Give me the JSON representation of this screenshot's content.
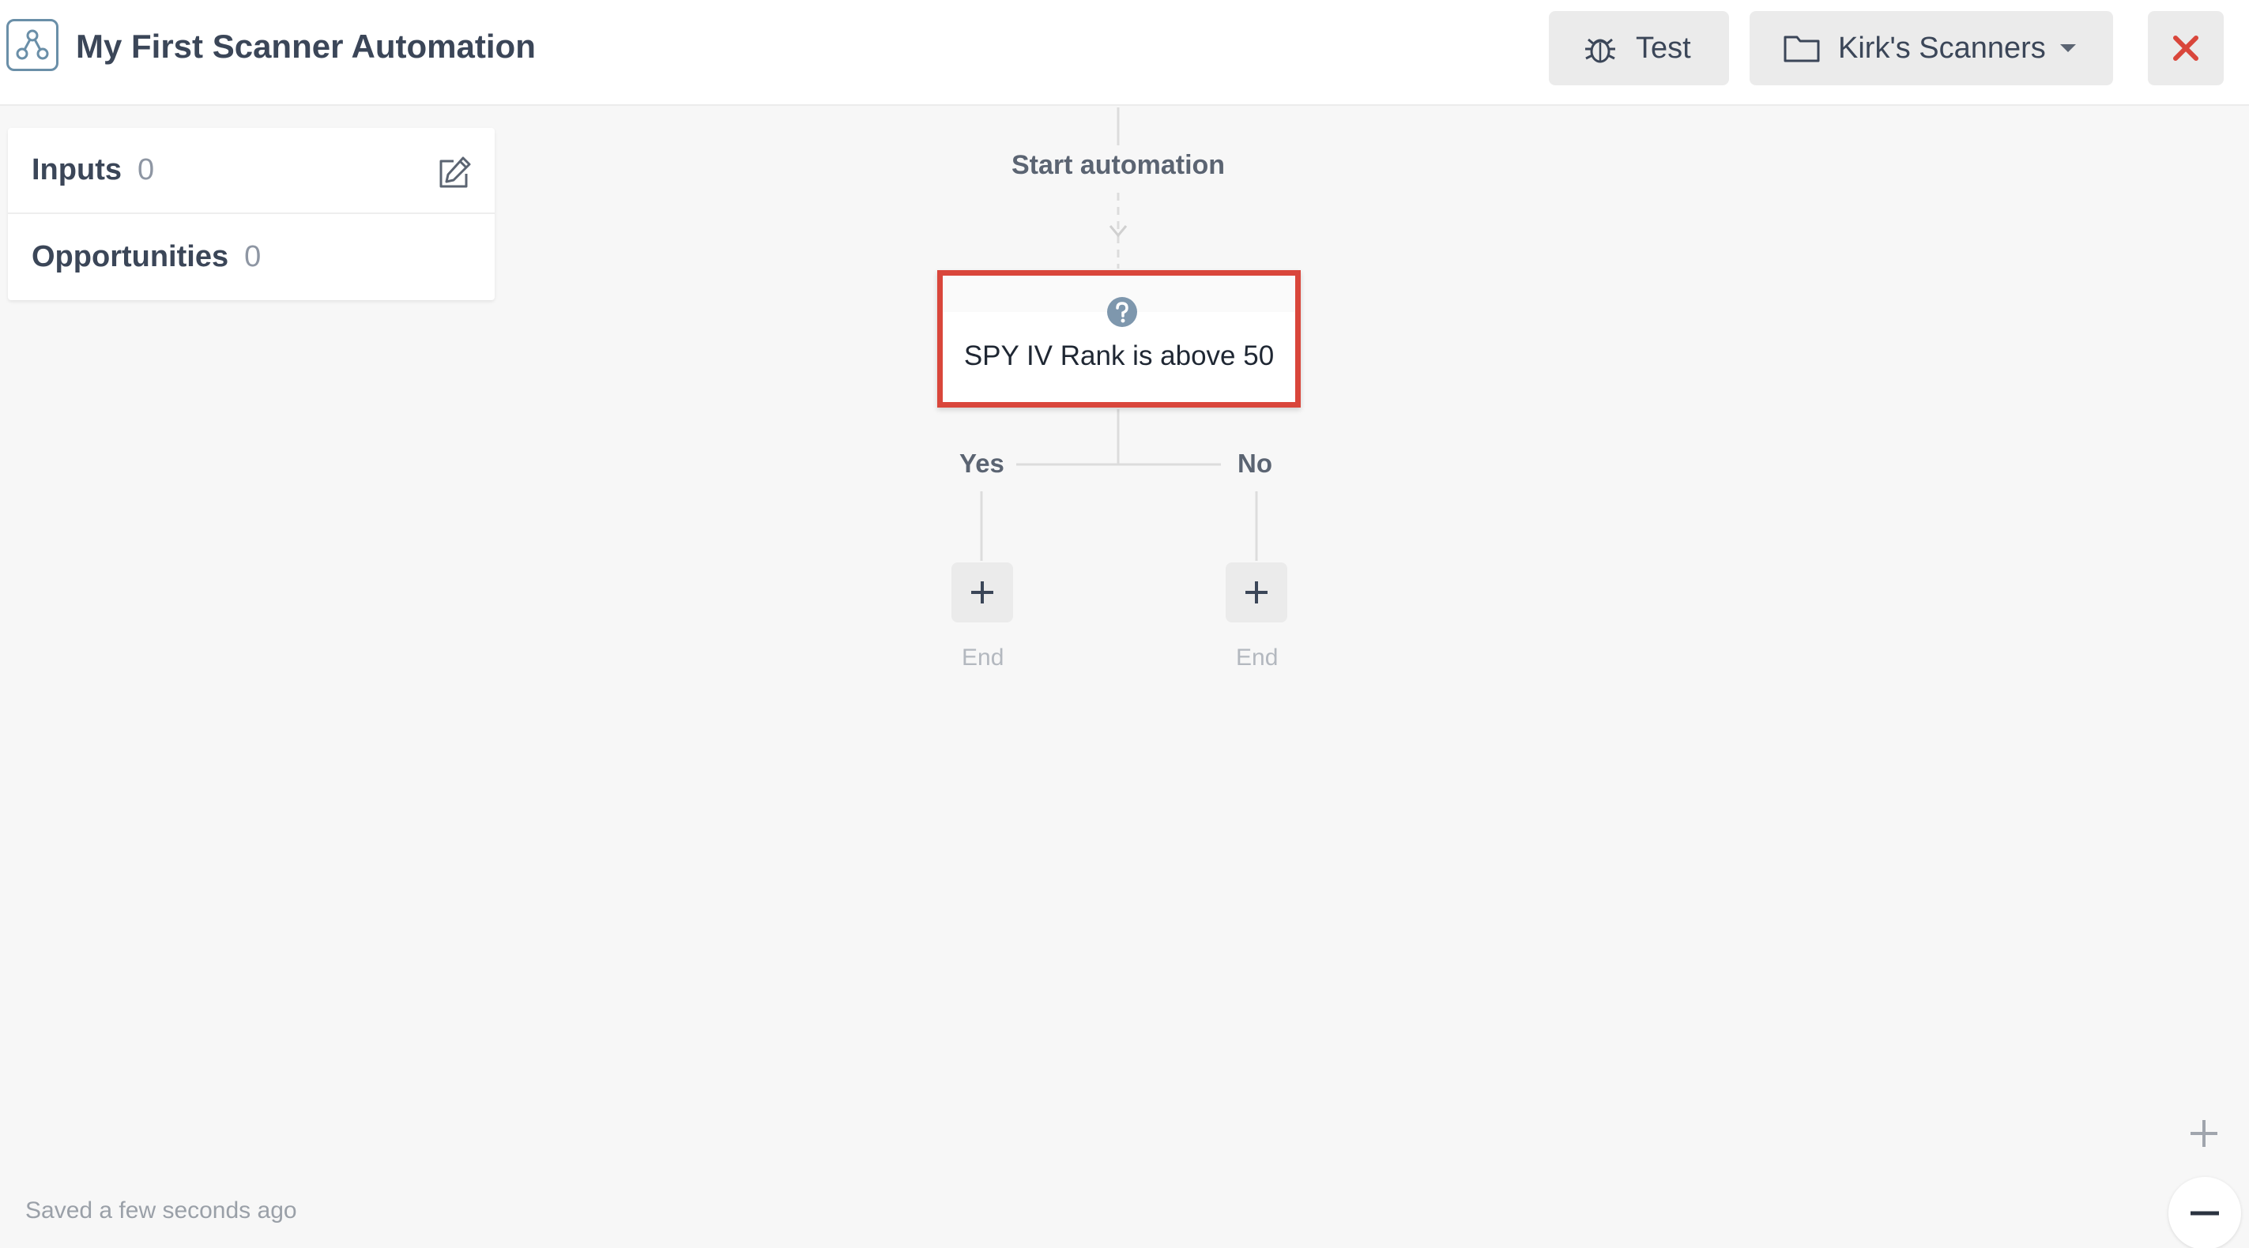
{
  "header": {
    "app_icon": "automation-nodes-icon",
    "title": "My First Scanner Automation",
    "test_button": {
      "label": "Test",
      "icon": "bug-icon"
    },
    "folder_button": {
      "label": "Kirk's Scanners",
      "icon": "folder-icon",
      "caret": "caret-down-icon"
    },
    "close_button": {
      "icon": "close-icon",
      "color": "#d9463b"
    }
  },
  "left_panel": {
    "inputs": {
      "label": "Inputs",
      "count": "0",
      "edit_icon": "edit-icon"
    },
    "opportunities": {
      "label": "Opportunities",
      "count": "0"
    }
  },
  "flow": {
    "start_label": "Start automation",
    "condition": {
      "text": "SPY IV Rank is above 50",
      "icon": "help-icon",
      "highlight_color": "#d9463b"
    },
    "branches": {
      "yes": {
        "label": "Yes",
        "end_label": "End"
      },
      "no": {
        "label": "No",
        "end_label": "End"
      }
    }
  },
  "footer": {
    "saved_status": "Saved a few seconds ago",
    "zoom_in_icon": "plus-icon",
    "zoom_out_icon": "minus-icon"
  }
}
